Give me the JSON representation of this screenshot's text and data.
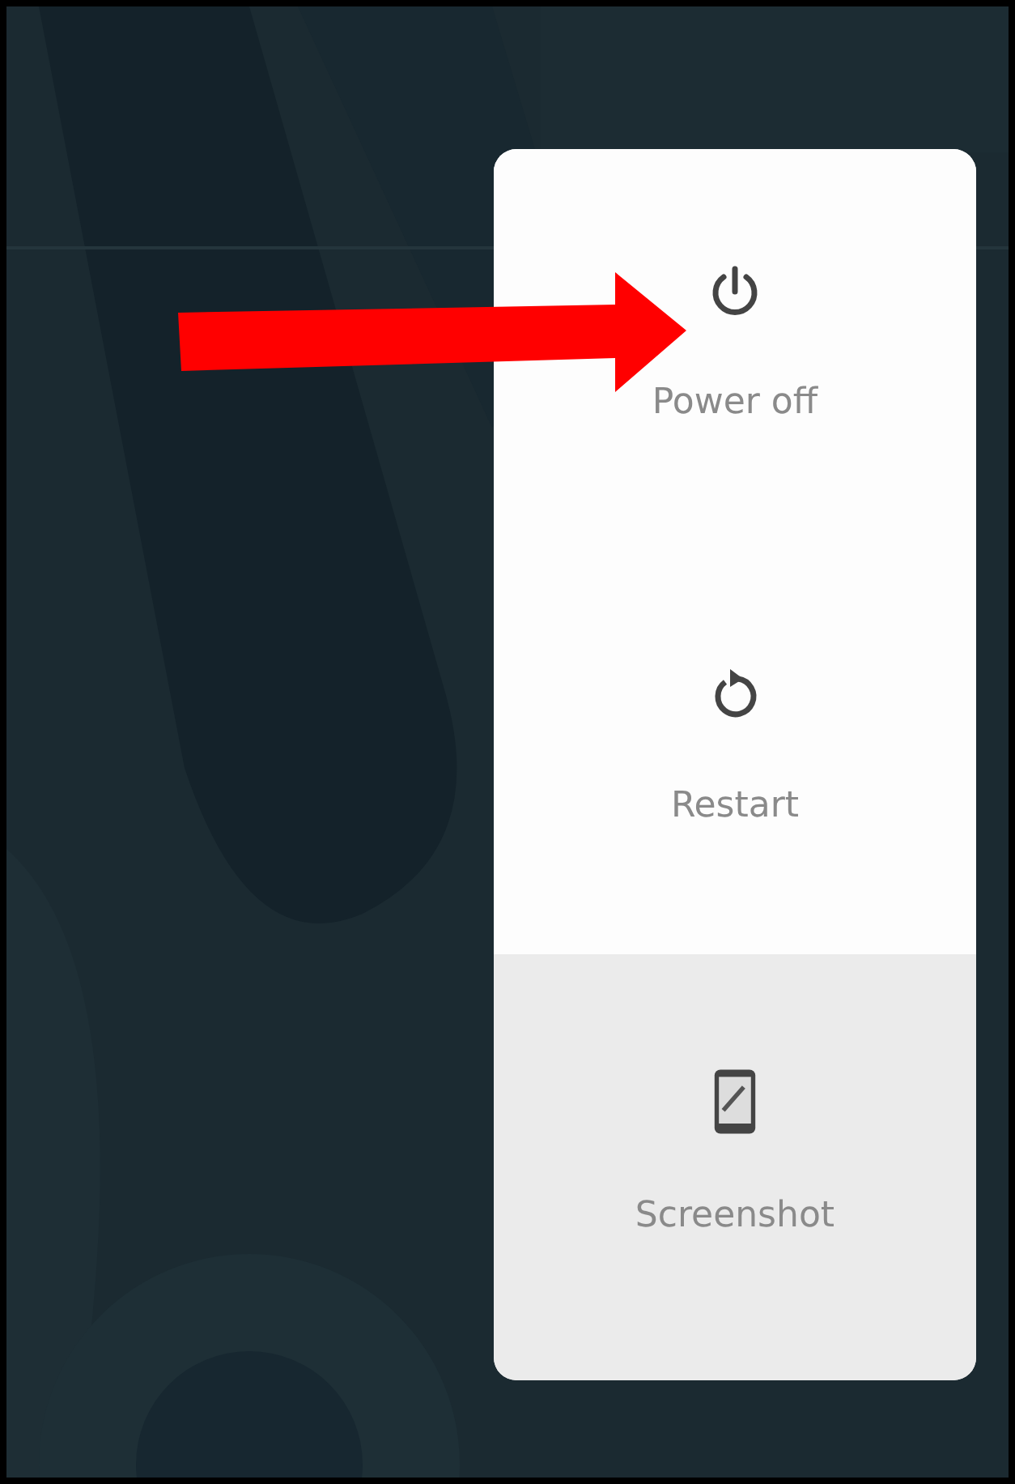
{
  "power_menu": {
    "items": [
      {
        "kind": "power",
        "label": "Power off",
        "highlighted": false
      },
      {
        "kind": "restart",
        "label": "Restart",
        "highlighted": false
      },
      {
        "kind": "screenshot",
        "label": "Screenshot",
        "highlighted": true
      }
    ]
  },
  "annotation": {
    "kind": "arrow"
  }
}
